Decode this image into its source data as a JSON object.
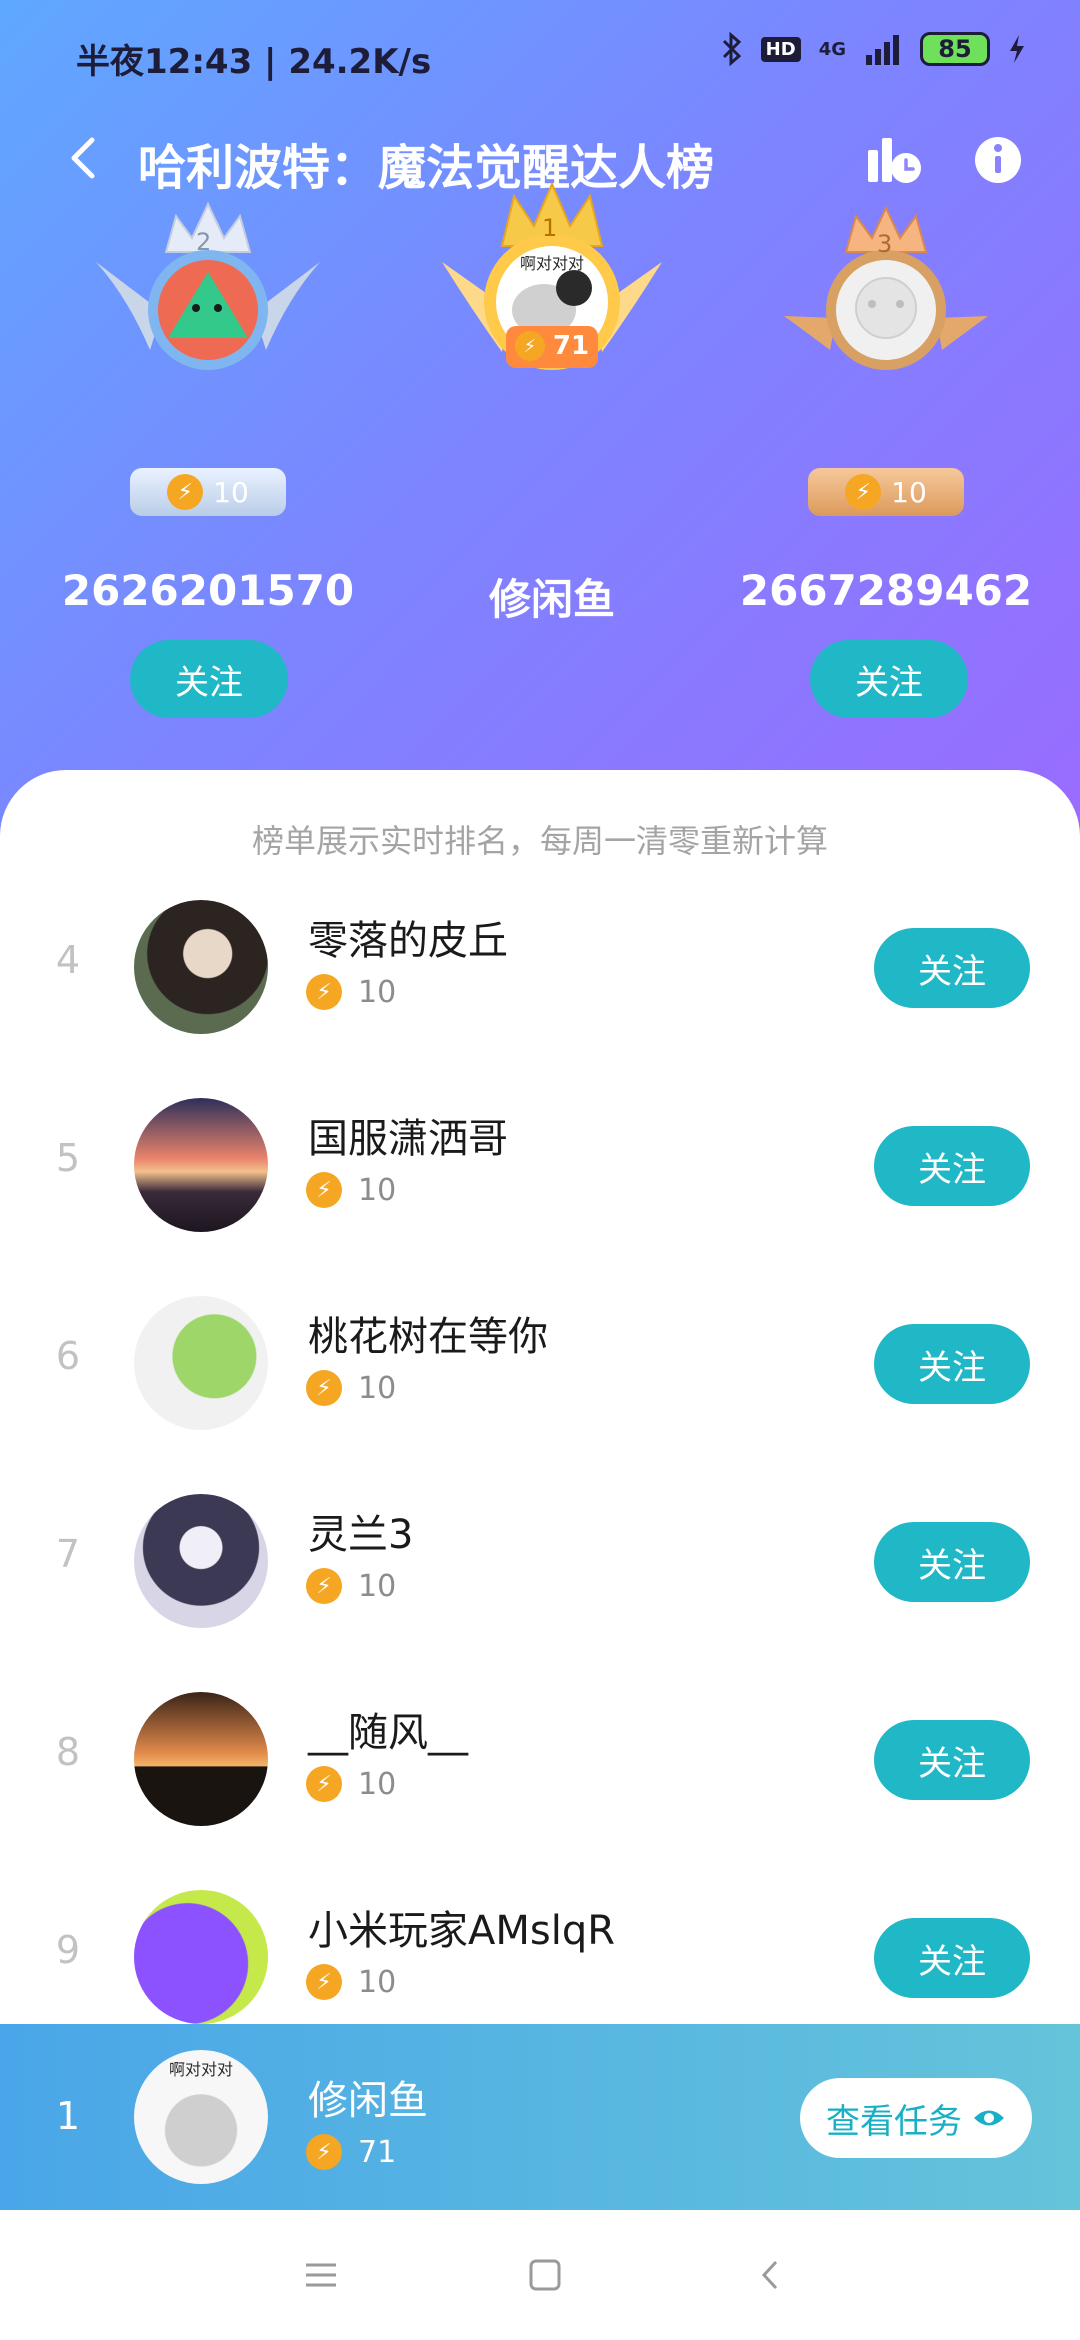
{
  "status": {
    "time": "半夜12:43 | 24.2K/s",
    "network": "4G",
    "battery": "85",
    "hd": "HD"
  },
  "header": {
    "title": "哈利波特：魔法觉醒达人榜"
  },
  "podium": [
    {
      "rank": "2",
      "name": "2626201570",
      "score": "10",
      "follow": "关注"
    },
    {
      "rank": "1",
      "name": "修闲鱼",
      "score": "71",
      "avatar_caption": "啊对对对"
    },
    {
      "rank": "3",
      "name": "2667289462",
      "score": "10",
      "follow": "关注"
    }
  ],
  "notice": "榜单展示实时排名，每周一清零重新计算",
  "list": [
    {
      "rank": "4",
      "name": "零落的皮丘",
      "score": "10",
      "follow": "关注"
    },
    {
      "rank": "5",
      "name": "国服潇洒哥",
      "score": "10",
      "follow": "关注"
    },
    {
      "rank": "6",
      "name": "桃花树在等你",
      "score": "10",
      "follow": "关注"
    },
    {
      "rank": "7",
      "name": "灵兰3",
      "score": "10",
      "follow": "关注"
    },
    {
      "rank": "8",
      "name": "__随风__",
      "score": "10",
      "follow": "关注"
    },
    {
      "rank": "9",
      "name": "小米玩家AMslqR",
      "score": "10",
      "follow": "关注"
    }
  ],
  "me": {
    "rank": "1",
    "name": "修闲鱼",
    "score": "71",
    "task_button": "查看任务",
    "avatar_caption": "啊对对对"
  },
  "colors": {
    "accent": "#20b8c6",
    "score_icon": "#f5a623",
    "gold": "#f7c948",
    "silver": "#c9d6ea",
    "bronze": "#e4a86b"
  },
  "icons": {
    "back": "chevron-left-icon",
    "stats": "chart-clock-icon",
    "info": "info-icon",
    "score": "lightning-icon",
    "eye": "eye-icon"
  }
}
